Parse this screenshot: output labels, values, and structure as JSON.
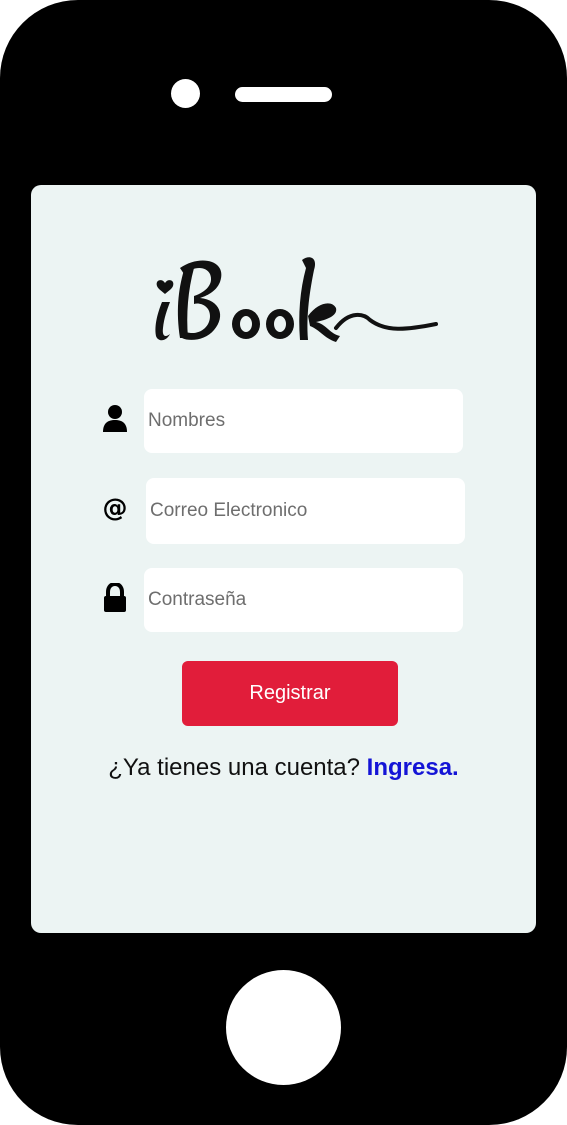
{
  "app": {
    "logo_text": "iBook"
  },
  "form": {
    "name_placeholder": "Nombres",
    "email_placeholder": "Correo Electronico",
    "email_icon_glyph": "@",
    "password_placeholder": "Contraseña",
    "register_label": "Registrar"
  },
  "footer": {
    "prompt": "¿Ya tienes una cuenta?",
    "login_link": "Ingresa."
  },
  "icons": {
    "name": "user-icon",
    "email": "at-sign-icon",
    "password": "lock-icon"
  },
  "colors": {
    "screen_bg": "#ecf4f3",
    "primary_button": "#e11d3a",
    "link": "#1414d6",
    "device": "#000000"
  }
}
